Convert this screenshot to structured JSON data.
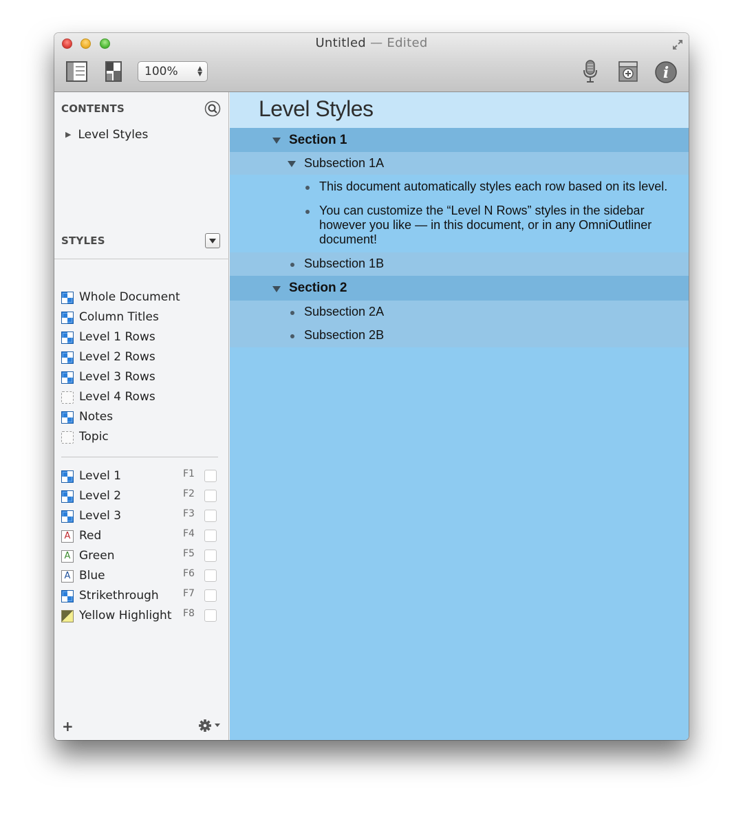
{
  "window": {
    "title": "Untitled",
    "title_suffix": "— Edited",
    "zoom_value": "100%"
  },
  "sidebar": {
    "contents_heading": "CONTENTS",
    "contents_items": [
      {
        "label": "Level Styles"
      }
    ],
    "styles_heading": "STYLES",
    "styles": [
      {
        "label": "Whole Document",
        "swatch": "blue"
      },
      {
        "label": "Column Titles",
        "swatch": "blue"
      },
      {
        "label": "Level 1 Rows",
        "swatch": "blue"
      },
      {
        "label": "Level 2 Rows",
        "swatch": "blue"
      },
      {
        "label": "Level 3 Rows",
        "swatch": "blue"
      },
      {
        "label": "Level 4 Rows",
        "swatch": "empty"
      },
      {
        "label": "Notes",
        "swatch": "blue"
      },
      {
        "label": "Topic",
        "swatch": "empty"
      }
    ],
    "named_styles": [
      {
        "label": "Level 1",
        "key": "F1",
        "swatch": "blue"
      },
      {
        "label": "Level 2",
        "key": "F2",
        "swatch": "blue"
      },
      {
        "label": "Level 3",
        "key": "F3",
        "swatch": "blue"
      },
      {
        "label": "Red",
        "key": "F4",
        "swatch": "letter",
        "letter": "A",
        "color": "#c0282d"
      },
      {
        "label": "Green",
        "key": "F5",
        "swatch": "letter",
        "letter": "A",
        "color": "#3b8a2e"
      },
      {
        "label": "Blue",
        "key": "F6",
        "swatch": "letter",
        "letter": "A",
        "color": "#1f4f9a"
      },
      {
        "label": "Strikethrough",
        "key": "F7",
        "swatch": "blue"
      },
      {
        "label": "Yellow Highlight",
        "key": "F8",
        "swatch": "yellow"
      }
    ],
    "add_label": "+"
  },
  "document": {
    "title": "Level Styles",
    "rows": [
      {
        "text": "Section 1",
        "level": 1,
        "marker": "disclosure"
      },
      {
        "text": "Subsection 1A",
        "level": 2,
        "marker": "disclosure"
      },
      {
        "text": "This document automatically styles each row based on its level.",
        "level": 3,
        "marker": "bullet"
      },
      {
        "text": "You can customize the “Level N Rows” styles in the sidebar however you like — in this document, or in any OmniOutliner document!",
        "level": 3,
        "marker": "bullet"
      },
      {
        "text": "Subsection 1B",
        "level": 2,
        "marker": "bullet"
      },
      {
        "text": "Section 2",
        "level": 1,
        "marker": "disclosure"
      },
      {
        "text": "Subsection 2A",
        "level": 2,
        "marker": "bullet"
      },
      {
        "text": "Subsection 2B",
        "level": 2,
        "marker": "bullet"
      }
    ]
  },
  "colors": {
    "level1_row": "#78b5dd",
    "level2_row": "#95c6e7",
    "level3_row": "#8ecbf1",
    "title_bar": "#c6e5f9"
  },
  "icons": {
    "toolbar": [
      "sidebar-toggle-icon",
      "inspector-layout-icon",
      "microphone-icon",
      "add-attachment-icon",
      "info-icon"
    ],
    "window": [
      "fullscreen-icon"
    ]
  }
}
